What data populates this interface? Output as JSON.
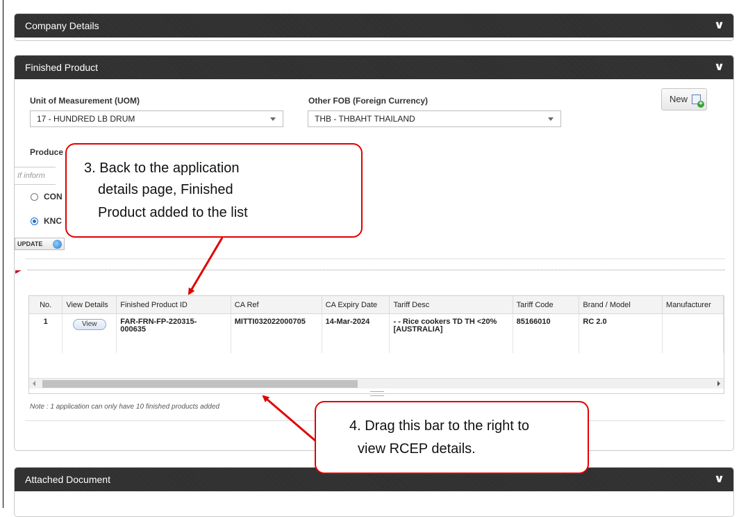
{
  "company_details": {
    "title": "Company Details"
  },
  "finished_product": {
    "title": "Finished Product",
    "uom": {
      "label": "Unit of Measurement (UOM)",
      "value": "17 - HUNDRED LB DRUM"
    },
    "fob": {
      "label": "Other FOB (Foreign Currency)",
      "value": "THB - THBAHT THAILAND"
    },
    "new_button": "New",
    "producer_label_partial": "Produce",
    "info_placeholder_partial": "If inform",
    "radio1_partial": "CON",
    "radio2_partial": "KNC",
    "update_button": "UPDATE",
    "table": {
      "columns": [
        "No.",
        "View Details",
        "Finished Product ID",
        "CA Ref",
        "CA Expiry Date",
        "Tariff Desc",
        "Tariff Code",
        "Brand / Model",
        "Manufacturer"
      ],
      "rows": [
        {
          "no": "1",
          "view": "View",
          "product_id_line1": "FAR-FRN-FP-220315-",
          "product_id_line2": "000635",
          "ca_ref": "MITTI032022000705",
          "ca_expiry": "14-Mar-2024",
          "tariff_desc_line1": "- - Rice cookers TD TH <20%",
          "tariff_desc_line2": "[AUSTRALIA]",
          "tariff_code": "85166010",
          "brand_model": "RC 2.0",
          "manufacturer": ""
        }
      ]
    },
    "note": "Note : 1 application can only have 10 finished products added"
  },
  "attached_document": {
    "title": "Attached Document"
  },
  "callouts": {
    "step3": {
      "line1": "3. Back to the application",
      "line2": "details page, Finished",
      "line3": "Product added to the list"
    },
    "step4": {
      "line1": "4. Drag this bar to the right to",
      "line2": "view RCEP details."
    }
  },
  "colors": {
    "header_bg": "#2e2e2e",
    "callout_border": "#e00000",
    "radio_checked": "#1f6fd6"
  },
  "icons": [
    "chevron-double-down-icon",
    "new-document-icon",
    "refresh-icon",
    "red-flag-icon"
  ]
}
